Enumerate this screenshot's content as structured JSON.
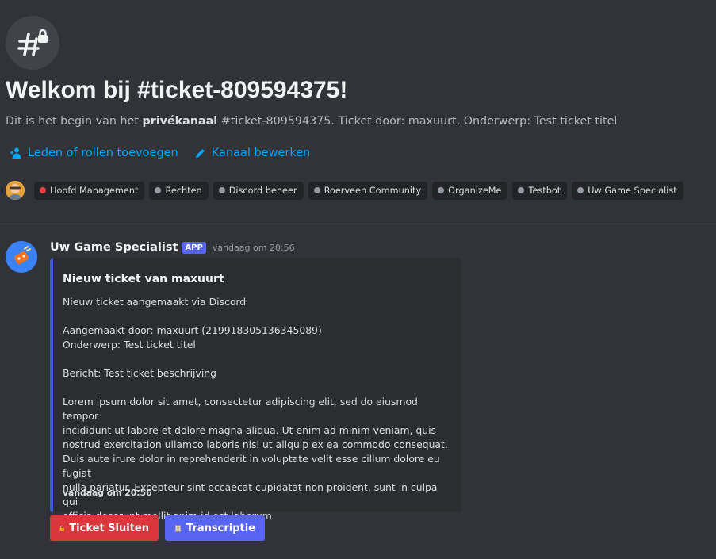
{
  "welcome": {
    "title": "Welkom bij #ticket-809594375!",
    "subtitle_prefix": "Dit is het begin van het ",
    "subtitle_bold": "privékanaal",
    "subtitle_suffix": " #ticket-809594375. Ticket door: maxuurt, Onderwerp: Test ticket titel"
  },
  "actions": {
    "add_members": "Leden of rollen toevoegen",
    "edit_channel": "Kanaal bewerken"
  },
  "roles": [
    {
      "name": "Hoofd Management",
      "color": "#f23f43"
    },
    {
      "name": "Rechten",
      "color": "#949ba4"
    },
    {
      "name": "Discord beheer",
      "color": "#949ba4"
    },
    {
      "name": "Roerveen Community",
      "color": "#949ba4"
    },
    {
      "name": "OrganizeMe",
      "color": "#949ba4"
    },
    {
      "name": "Testbot",
      "color": "#949ba4"
    },
    {
      "name": "Uw Game Specialist",
      "color": "#949ba4"
    }
  ],
  "message": {
    "author": "Uw Game Specialist",
    "tag": "APP",
    "timestamp": "vandaag om 20:56",
    "embed": {
      "title": "Nieuw ticket van maxuurt",
      "line1": "Nieuw ticket aangemaakt via Discord",
      "line2": "Aangemaakt door: maxuurt (219918305136345089)",
      "line3": "Onderwerp: Test ticket titel",
      "line4": "Bericht: Test ticket beschrijving",
      "lorem_1": "Lorem ipsum dolor sit amet, consectetur adipiscing elit, sed do eiusmod tempor",
      "lorem_2": "incididunt ut labore et dolore magna aliqua. Ut enim ad minim veniam, quis",
      "lorem_3": "nostrud exercitation ullamco laboris nisi ut aliquip ex ea commodo consequat.",
      "lorem_4": "Duis aute irure dolor in reprehenderit in voluptate velit esse cillum dolore eu fugiat",
      "lorem_5": "nulla pariatur. Excepteur sint occaecat cupidatat non proident, sunt in culpa qui",
      "lorem_6": "officia deserunt mollit anim id est laborum",
      "footer": "vandaag om 20:56",
      "accent_color": "#3b5bdb"
    },
    "buttons": {
      "close": "Ticket Sluiten",
      "transcript": "Transcriptie"
    }
  },
  "colors": {
    "background": "#313338",
    "link": "#00a8fc",
    "danger": "#da373c",
    "primary": "#5865f2"
  },
  "icons": {
    "channel": "hash-lock-icon",
    "add_members": "add-members-icon",
    "edit": "pencil-icon",
    "close": "lock-icon",
    "transcript": "scroll-icon"
  }
}
